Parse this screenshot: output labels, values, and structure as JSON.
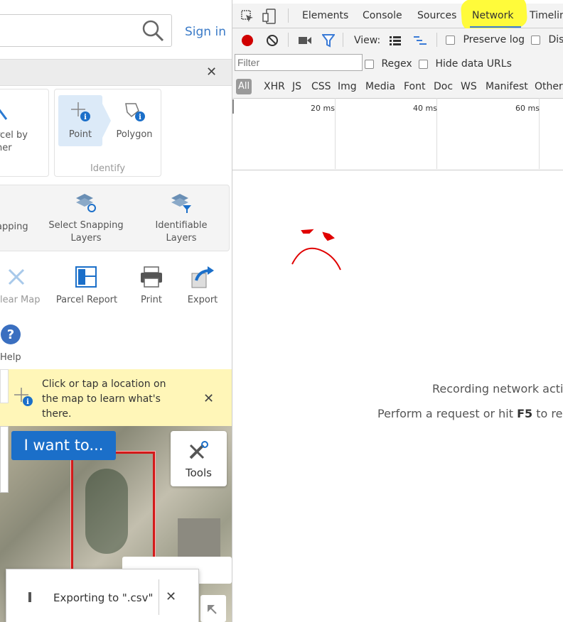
{
  "app": {
    "signin": "Sign in",
    "tools_row": [
      {
        "id": "parcel-owner",
        "label": "rcel by\nner"
      },
      {
        "id": "point",
        "label": "Point"
      },
      {
        "id": "polygon",
        "label": "Polygon"
      }
    ],
    "identify_group": "Identify",
    "snap_row": [
      {
        "id": "snapping",
        "label": "apping"
      },
      {
        "id": "select-snapping-layers",
        "label": "Select Snapping\nLayers"
      },
      {
        "id": "identifiable-layers",
        "label": "Identifiable\nLayers"
      }
    ],
    "actions": [
      {
        "id": "clear-map",
        "label": "lear Map"
      },
      {
        "id": "parcel-report",
        "label": "Parcel Report"
      },
      {
        "id": "print",
        "label": "Print"
      },
      {
        "id": "export",
        "label": "Export"
      }
    ],
    "help": "Help",
    "hint": "Click or tap a location on the map to learn what's there.",
    "iwant": "I want to...",
    "tools": "Tools",
    "toast": "Exporting to \".csv\""
  },
  "devtools": {
    "tabs": [
      "Elements",
      "Console",
      "Sources",
      "Network",
      "Timelin"
    ],
    "active_tab": "Network",
    "view_label": "View:",
    "preserve_log": "Preserve log",
    "disable_cache": "Disa",
    "filter_placeholder": "Filter",
    "regex": "Regex",
    "hide_data_urls": "Hide data URLs",
    "types": [
      "All",
      "XHR",
      "JS",
      "CSS",
      "Img",
      "Media",
      "Font",
      "Doc",
      "WS",
      "Manifest",
      "Other"
    ],
    "timeline_labels": [
      "20 ms",
      "40 ms",
      "60 ms"
    ],
    "empty_line1": "Recording network activ",
    "empty_line2_prefix": "Perform a request or hit ",
    "empty_line2_key": "F5",
    "empty_line2_suffix": " to reco"
  },
  "colors": {
    "accent": "#1b6fc9",
    "highlight": "#fffb3a",
    "record": "#d00000",
    "annotation": "#e00000"
  }
}
